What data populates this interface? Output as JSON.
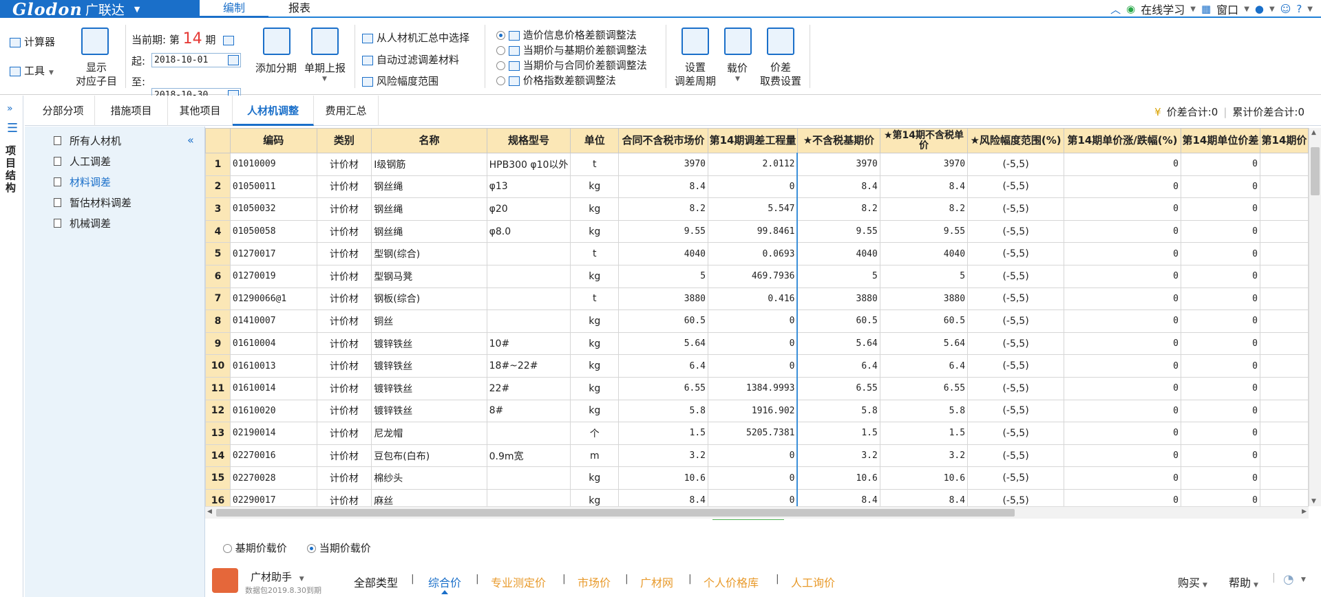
{
  "app": {
    "logo": "Glodon",
    "brand_cn": "广联达"
  },
  "top_tabs": [
    "编制",
    "报表"
  ],
  "top_right": {
    "online_learning": "在线学习",
    "window": "窗口",
    "help": "?"
  },
  "ribbon": {
    "calculator": "计算器",
    "tools": "工具",
    "show_sub": [
      "显示",
      "对应子目"
    ],
    "period_label": "当前期:",
    "period_prefix": "第",
    "period_value": "14",
    "period_suffix": "期",
    "start_label": "起:",
    "start_date": "2018-10-01",
    "end_label": "至:",
    "end_date": "2018-10-30",
    "add_period": "添加分期",
    "single_report": "单期上报",
    "select_from_summary": "从人材机汇总中选择",
    "auto_filter": "自动过滤调差材料",
    "risk_range": "风险幅度范围",
    "methods": [
      "造价信息价格差额调整法",
      "当期价与基期价差额调整法",
      "当期价与合同价差额调整法",
      "价格指数差额调整法"
    ],
    "set_cycle": [
      "设置",
      "调差周期"
    ],
    "load_price": "载价",
    "price_diff": [
      "价差",
      "取费设置"
    ]
  },
  "side_title": "项目结构",
  "sub_tabs": [
    "分部分项",
    "措施项目",
    "其他项目",
    "人材机调整",
    "费用汇总"
  ],
  "sums": {
    "diff_total": "价差合计:0",
    "cum_diff_total": "累计价差合计:0"
  },
  "tree": [
    "所有人材机",
    "人工调差",
    "材料调差",
    "暂估材料调差",
    "机械调差"
  ],
  "table": {
    "headers": [
      "编码",
      "类别",
      "名称",
      "规格型号",
      "单位",
      "合同不含税市场价",
      "第14期调差工程量",
      "★不含税基期价",
      "★第14期不含税单价",
      "★风险幅度范围(%)",
      "第14期单价涨/跌幅(%)",
      "第14期单位价差",
      "第14期价"
    ],
    "rows": [
      [
        "1",
        "01010009",
        "计价材",
        "Ⅰ级钢筋",
        "HPB300 φ10以外",
        "t",
        "3970",
        "2.0112",
        "3970",
        "3970",
        "(-5,5)",
        "0",
        "0"
      ],
      [
        "2",
        "01050011",
        "计价材",
        "钢丝绳",
        "φ13",
        "kg",
        "8.4",
        "0",
        "8.4",
        "8.4",
        "(-5,5)",
        "0",
        "0"
      ],
      [
        "3",
        "01050032",
        "计价材",
        "钢丝绳",
        "φ20",
        "kg",
        "8.2",
        "5.547",
        "8.2",
        "8.2",
        "(-5,5)",
        "0",
        "0"
      ],
      [
        "4",
        "01050058",
        "计价材",
        "钢丝绳",
        "φ8.0",
        "kg",
        "9.55",
        "99.8461",
        "9.55",
        "9.55",
        "(-5,5)",
        "0",
        "0"
      ],
      [
        "5",
        "01270017",
        "计价材",
        "型钢(综合)",
        "",
        "t",
        "4040",
        "0.0693",
        "4040",
        "4040",
        "(-5,5)",
        "0",
        "0"
      ],
      [
        "6",
        "01270019",
        "计价材",
        "型钢马凳",
        "",
        "kg",
        "5",
        "469.7936",
        "5",
        "5",
        "(-5,5)",
        "0",
        "0"
      ],
      [
        "7",
        "01290066@1",
        "计价材",
        "钢板(综合)",
        "",
        "t",
        "3880",
        "0.416",
        "3880",
        "3880",
        "(-5,5)",
        "0",
        "0"
      ],
      [
        "8",
        "01410007",
        "计价材",
        "铜丝",
        "",
        "kg",
        "60.5",
        "0",
        "60.5",
        "60.5",
        "(-5,5)",
        "0",
        "0"
      ],
      [
        "9",
        "01610004",
        "计价材",
        "镀锌铁丝",
        "10#",
        "kg",
        "5.64",
        "0",
        "5.64",
        "5.64",
        "(-5,5)",
        "0",
        "0"
      ],
      [
        "10",
        "01610013",
        "计价材",
        "镀锌铁丝",
        "18#~22#",
        "kg",
        "6.4",
        "0",
        "6.4",
        "6.4",
        "(-5,5)",
        "0",
        "0"
      ],
      [
        "11",
        "01610014",
        "计价材",
        "镀锌铁丝",
        "22#",
        "kg",
        "6.55",
        "1384.9993",
        "6.55",
        "6.55",
        "(-5,5)",
        "0",
        "0"
      ],
      [
        "12",
        "01610020",
        "计价材",
        "镀锌铁丝",
        "8#",
        "kg",
        "5.8",
        "1916.902",
        "5.8",
        "5.8",
        "(-5,5)",
        "0",
        "0"
      ],
      [
        "13",
        "02190014",
        "计价材",
        "尼龙帽",
        "",
        "个",
        "1.5",
        "5205.7381",
        "1.5",
        "1.5",
        "(-5,5)",
        "0",
        "0"
      ],
      [
        "14",
        "02270016",
        "计价材",
        "豆包布(白布)",
        "0.9m宽",
        "m",
        "3.2",
        "0",
        "3.2",
        "3.2",
        "(-5,5)",
        "0",
        "0"
      ],
      [
        "15",
        "02270028",
        "计价材",
        "棉纱头",
        "",
        "kg",
        "10.6",
        "0",
        "10.6",
        "10.6",
        "(-5,5)",
        "0",
        "0"
      ],
      [
        "16",
        "02290017",
        "计价材",
        "麻丝",
        "",
        "kg",
        "8.4",
        "0",
        "8.4",
        "8.4",
        "(-5,5)",
        "0",
        "0"
      ]
    ]
  },
  "bottom": {
    "radio_base": "基期价载价",
    "radio_current": "当期价载价",
    "assistant": "广材助手",
    "data_pack": "数据包2019.8.30到期",
    "links": [
      "全部类型",
      "综合价",
      "专业测定价",
      "市场价",
      "广材网",
      "个人价格库",
      "人工询价"
    ],
    "buy": "购买",
    "help": "帮助"
  },
  "colors": {
    "accent": "#1a6fc9",
    "header_bg": "#fbe7b6",
    "tree_bg": "#eaf3fa",
    "link_orange": "#e89a2b"
  }
}
